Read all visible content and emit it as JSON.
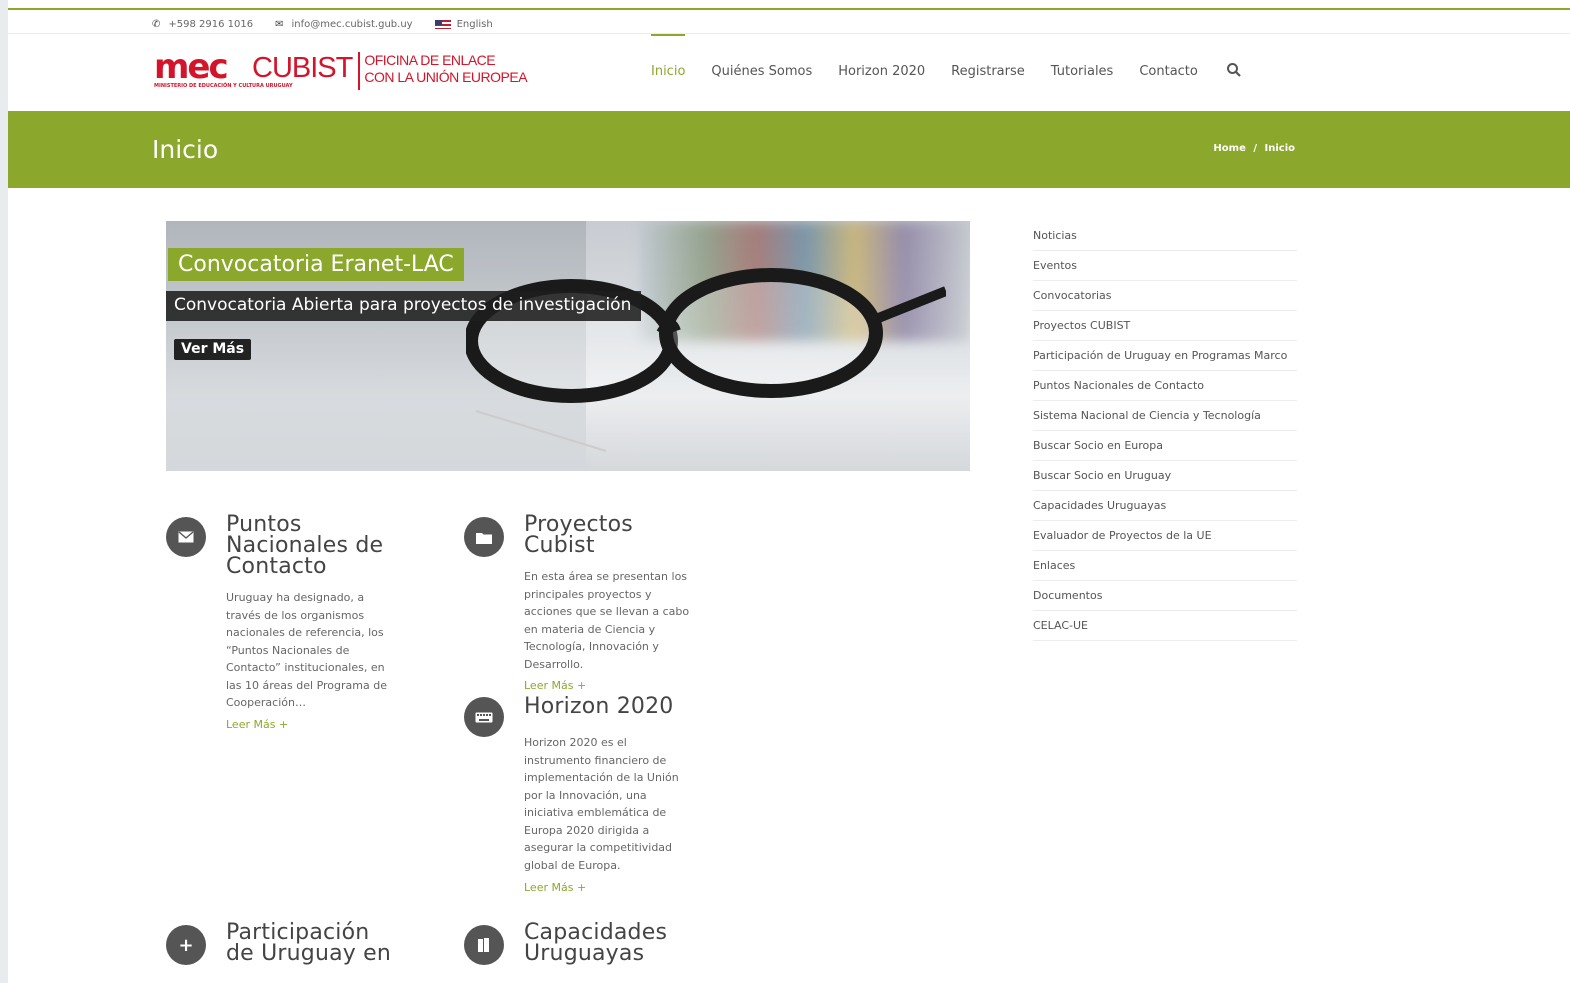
{
  "topbar": {
    "phone": "+598 2916 1016",
    "email": "info@mec.cubist.gub.uy",
    "language": "English"
  },
  "logo": {
    "mec": "mec",
    "ministry": "MINISTERIO DE EDUCACIÓN Y CULTURA URUGUAY",
    "cubist": "CUBIST",
    "office_line1": "OFICINA DE ENLACE",
    "office_line2": "CON LA UNIÓN EUROPEA"
  },
  "nav": {
    "items": [
      "Inicio",
      "Quiénes Somos",
      "Horizon 2020",
      "Registrarse",
      "Tutoriales",
      "Contacto"
    ],
    "active": "Inicio"
  },
  "page": {
    "title": "Inicio",
    "breadcrumb": [
      "Home",
      "Inicio"
    ],
    "breadcrumb_sep": "/"
  },
  "slider": {
    "title": "Convocatoria Eranet-LAC",
    "subtitle": "Convocatoria Abierta para proyectos de investigación",
    "button": "Ver Más"
  },
  "features": [
    {
      "title_lines": [
        "Puntos",
        "Nacionales de",
        "Contacto"
      ],
      "text_lines": [
        "Uruguay ha designado, a",
        "través de los organismos",
        "nacionales de referencia, los",
        "“Puntos Nacionales de",
        "Contacto” institucionales, en",
        "las 10 áreas del Programa de",
        "Cooperación…"
      ],
      "more": "Leer Más +"
    },
    {
      "title_lines": [
        "Proyectos",
        "Cubist"
      ],
      "text_lines": [
        "En esta área se presentan los",
        "principales proyectos y",
        "acciones que se llevan a cabo",
        "en materia de Ciencia y",
        "Tecnología, Innovación y",
        "Desarrollo."
      ],
      "more": "Leer Más +"
    },
    {
      "title_lines": [
        "Horizon 2020"
      ],
      "text_lines": [
        "Horizon 2020 es el",
        "instrumento financiero de",
        "implementación de la Unión",
        "por la Innovación, una",
        "iniciativa emblemática de",
        "Europa 2020 dirigida a",
        "asegurar la competitividad",
        "global de Europa."
      ],
      "more": "Leer Más +"
    },
    {
      "title_lines": [
        "Participación",
        "de Uruguay en"
      ]
    },
    {
      "title_lines": [
        "Capacidades",
        "Uruguayas"
      ]
    }
  ],
  "sidebar": {
    "items": [
      "Noticias",
      "Eventos",
      "Convocatorias",
      "Proyectos CUBIST",
      "Participación de Uruguay en Programas Marco",
      "Puntos Nacionales de Contacto",
      "Sistema Nacional de Ciencia y Tecnología",
      "Buscar Socio en Europa",
      "Buscar Socio en Uruguay",
      "Capacidades Uruguayas",
      "Evaluador de Proyectos de la UE",
      "Enlaces",
      "Documentos",
      "CELAC-UE"
    ]
  },
  "colors": {
    "accent": "#8ba82d",
    "brand_red": "#d3142a",
    "icon_bg": "#555555"
  },
  "icons": {
    "phone": "phone-icon",
    "email": "envelope-icon",
    "language": "us-flag-icon",
    "search": "search-icon",
    "feature1": "envelope-icon",
    "feature2": "folder-icon",
    "feature3": "keyboard-icon",
    "feature4": "plus-icon",
    "feature5": "book-icon"
  }
}
